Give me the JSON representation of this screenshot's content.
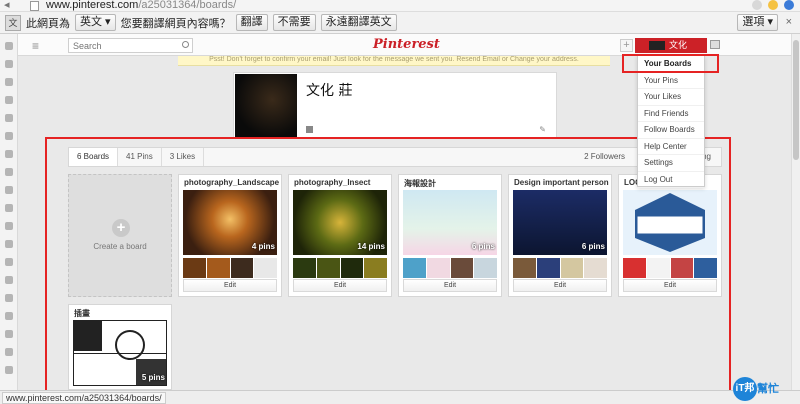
{
  "browser": {
    "url_host": "www.pinterest.com",
    "url_path": "/a25031364/boards/",
    "status_url": "www.pinterest.com/a25031364/boards/"
  },
  "translate_bar": {
    "prompt_prefix": "此網頁為",
    "language": "英文",
    "prompt_suffix": "您要翻譯網頁內容嗎？",
    "translate_label": "翻譯",
    "no_label": "不需要",
    "always_label": "永遠翻譯英文",
    "options_label": "選項",
    "close_glyph": "×"
  },
  "header": {
    "search_placeholder": "Search",
    "logo": "Pinterest",
    "plus_glyph": "+",
    "user_name": "文化"
  },
  "banner": {
    "text": "Psst! Don't forget to confirm your email! Just look for the message we sent you. Resend Email or Change your address."
  },
  "profile": {
    "name": "文化 莊",
    "edit_glyph": "✎"
  },
  "tabs": {
    "boards": "6 Boards",
    "pins": "41 Pins",
    "likes": "3 Likes",
    "followers": "2 Followers",
    "following": "ng"
  },
  "create_board": {
    "plus_glyph": "+",
    "label": "Create a board"
  },
  "boards": [
    {
      "title": "photography_Landscape",
      "pins": "4 pins",
      "edit": "Edit"
    },
    {
      "title": "photography_Insect",
      "pins": "14 pins",
      "edit": "Edit"
    },
    {
      "title": "海報設計",
      "pins": "6 pins",
      "edit": "Edit"
    },
    {
      "title": "Design important person ...",
      "pins": "6 pins",
      "edit": "Edit"
    },
    {
      "title": "LOG",
      "pins": "",
      "edit": "Edit"
    },
    {
      "title": "插畫",
      "pins": "5 pins",
      "edit": ""
    }
  ],
  "dropdown": {
    "items": [
      "Your Boards",
      "Your Pins",
      "Your Likes",
      "Find Friends",
      "Follow Boards",
      "Help Center",
      "Settings",
      "Log Out"
    ]
  },
  "watermark": {
    "circle": "iT邦",
    "text": "幫忙"
  },
  "colors": {
    "pinterest_red": "#cb2027",
    "highlight_red": "#e52323",
    "banner_yellow": "#fff7c7"
  }
}
